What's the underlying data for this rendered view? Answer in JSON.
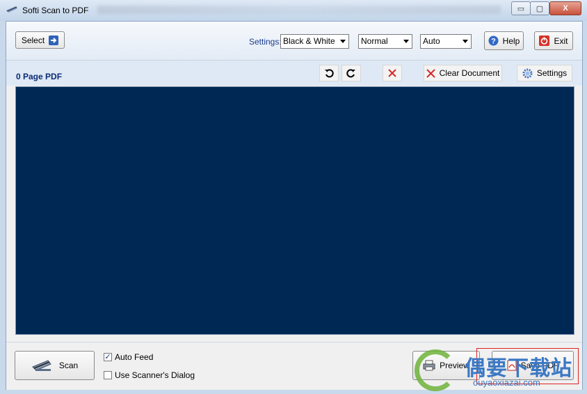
{
  "window": {
    "title": "Softi Scan to PDF",
    "controls": {
      "minimize": "▭",
      "maximize": "▢",
      "close": "X"
    }
  },
  "toolbar": {
    "select_label": "Select",
    "settings_label": "Settings:",
    "color_mode": "Black & White",
    "quality": "Normal",
    "page_size": "Auto",
    "help_label": "Help",
    "exit_label": "Exit"
  },
  "document": {
    "page_count_label": "0 Page PDF",
    "clear_label": "Clear Document",
    "settings_label": "Settings"
  },
  "bottom": {
    "scan_label": "Scan",
    "auto_feed_label": "Auto Feed",
    "auto_feed_checked": true,
    "scanner_dialog_label": "Use Scanner's Dialog",
    "scanner_dialog_checked": false,
    "preview_label": "Preview",
    "save_label": "Save PDF"
  },
  "watermark": {
    "chinese": "偶要下载站",
    "url": "ouyaoxiazai.com"
  },
  "colors": {
    "viewer_bg": "#002855",
    "title_blue": "#0a2a78",
    "highlight": "#e02020",
    "watermark_blue": "#3b78c4",
    "watermark_green": "#6fb33a"
  }
}
